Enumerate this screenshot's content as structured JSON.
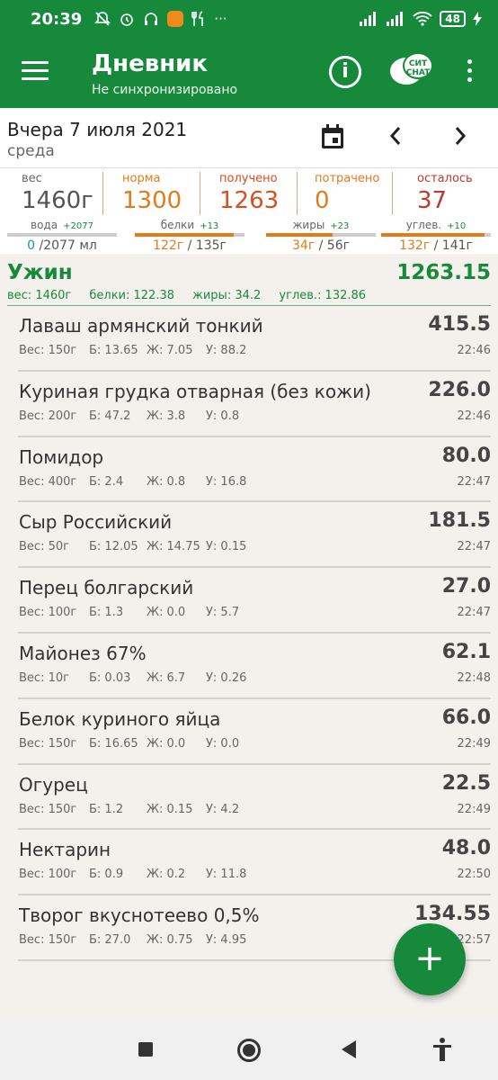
{
  "status": {
    "time": "20:39",
    "battery": "48",
    "dots": "···"
  },
  "toolbar": {
    "title": "Дневник",
    "subtitle": "Не синхронизировано",
    "info_glyph": "i",
    "chat_text": "СИТ CHAT"
  },
  "date": {
    "main": "Вчера 7 июля 2021",
    "day": "среда"
  },
  "summary": [
    {
      "label": "вес",
      "value": "1460г",
      "label_color": "#666666",
      "value_color": "#555555"
    },
    {
      "label": "норма",
      "value": "1300",
      "label_color": "#e07c1a",
      "value_color": "#e07c1a"
    },
    {
      "label": "получено",
      "value": "1263",
      "label_color": "#d94e1e",
      "value_color": "#d94e1e"
    },
    {
      "label": "потрачено",
      "value": "0",
      "label_color": "#e07c1a",
      "value_color": "#e07c1a"
    },
    {
      "label": "осталось",
      "value": "37",
      "label_color": "#c0392b",
      "value_color": "#c0392b"
    }
  ],
  "macros": [
    {
      "label": "вода",
      "delta": "+2077",
      "cur": "0",
      "total": " /2077 мл",
      "fill": 0,
      "blue": true
    },
    {
      "label": "белки",
      "delta": "+13",
      "cur": "122г",
      "total": " / 135г",
      "fill": 0.9,
      "blue": false
    },
    {
      "label": "жиры",
      "delta": "+23",
      "cur": "34г",
      "total": " / 56г",
      "fill": 0.61,
      "blue": false
    },
    {
      "label": "углев.",
      "delta": "+10",
      "cur": "132г",
      "total": " / 141г",
      "fill": 0.94,
      "blue": false
    }
  ],
  "meal": {
    "name": "Ужин",
    "total": "1263.15",
    "weight": "вес: 1460г",
    "protein": "белки: 122.38",
    "fat": "жиры: 34.2",
    "carbs": "углев.: 132.86"
  },
  "items": [
    {
      "name": "Лаваш армянский тонкий",
      "kcal": "415.5",
      "w": "Вес: 150г",
      "p": "Б: 13.65",
      "f": "Ж: 7.05",
      "c": "У: 88.2",
      "time": "22:46"
    },
    {
      "name": "Куриная грудка отварная (без кожи)",
      "kcal": "226.0",
      "w": "Вес: 200г",
      "p": "Б: 47.2",
      "f": "Ж: 3.8",
      "c": "У: 0.8",
      "time": "22:46"
    },
    {
      "name": "Помидор",
      "kcal": "80.0",
      "w": "Вес: 400г",
      "p": "Б: 2.4",
      "f": "Ж: 0.8",
      "c": "У: 16.8",
      "time": "22:47"
    },
    {
      "name": "Сыр Российский",
      "kcal": "181.5",
      "w": "Вес: 50г",
      "p": "Б: 12.05",
      "f": "Ж: 14.75",
      "c": "У: 0.15",
      "time": "22:47"
    },
    {
      "name": "Перец болгарский",
      "kcal": "27.0",
      "w": "Вес: 100г",
      "p": "Б: 1.3",
      "f": "Ж: 0.0",
      "c": "У: 5.7",
      "time": "22:47"
    },
    {
      "name": "Майонез 67%",
      "kcal": "62.1",
      "w": "Вес: 10г",
      "p": "Б: 0.03",
      "f": "Ж: 6.7",
      "c": "У: 0.26",
      "time": "22:48"
    },
    {
      "name": "Белок куриного яйца",
      "kcal": "66.0",
      "w": "Вес: 150г",
      "p": "Б: 16.65",
      "f": "Ж: 0.0",
      "c": "У: 0.0",
      "time": "22:49"
    },
    {
      "name": "Огурец",
      "kcal": "22.5",
      "w": "Вес: 150г",
      "p": "Б: 1.2",
      "f": "Ж: 0.15",
      "c": "У: 4.2",
      "time": "22:49"
    },
    {
      "name": "Нектарин",
      "kcal": "48.0",
      "w": "Вес: 100г",
      "p": "Б: 0.9",
      "f": "Ж: 0.2",
      "c": "У: 11.8",
      "time": "22:50"
    },
    {
      "name": "Творог вкуснотеево 0,5%",
      "kcal": "134.55",
      "w": "Вес: 150г",
      "p": "Б: 27.0",
      "f": "Ж: 0.75",
      "c": "У: 4.95",
      "time": "22:57"
    }
  ],
  "fab_glyph": "+",
  "colors": {
    "primary": "#168a3a",
    "accent": "#e07c1a"
  }
}
